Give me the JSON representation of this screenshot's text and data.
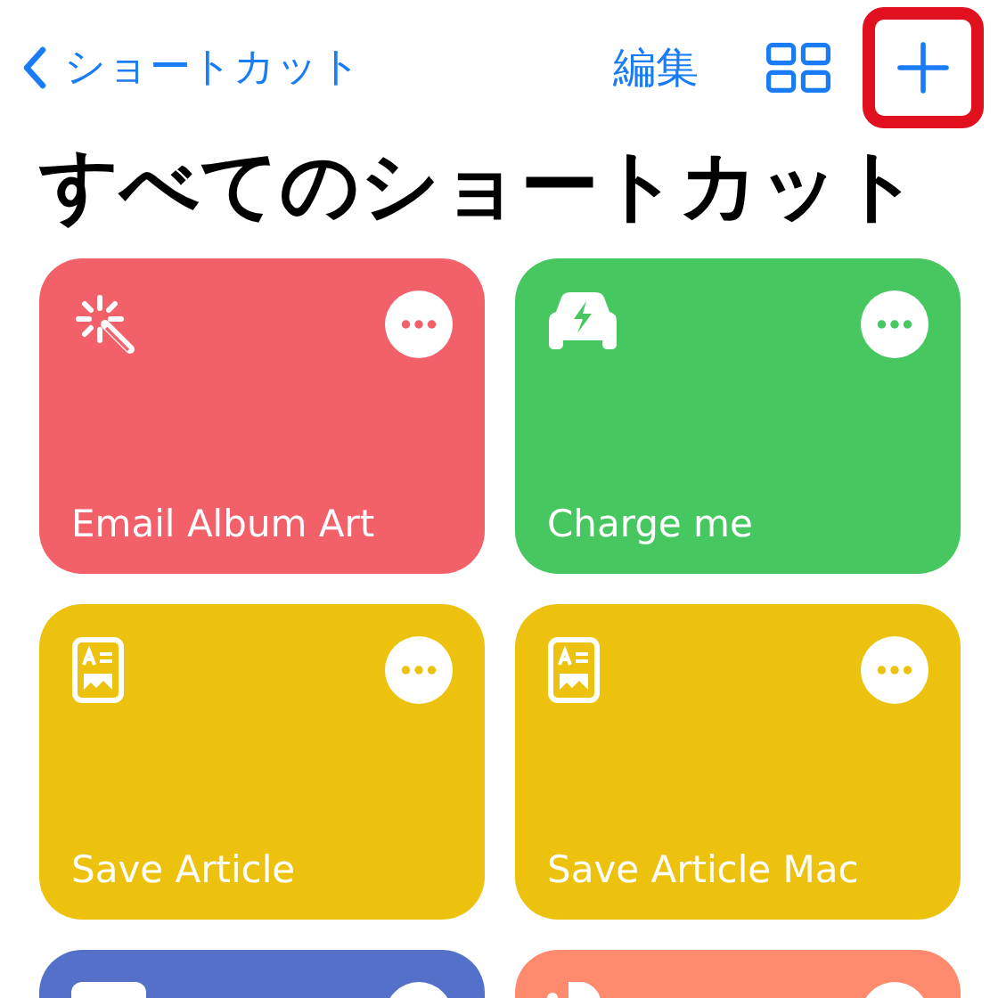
{
  "nav": {
    "back_label": "ショートカット",
    "edit_label": "編集",
    "add_highlighted": true
  },
  "title": "すべてのショートカット",
  "shortcuts": [
    {
      "label": "Email Album Art",
      "color": "#f2606a"
    },
    {
      "label": "Charge me",
      "color": "#46c760"
    },
    {
      "label": "Save Article",
      "color": "#ecc20f"
    },
    {
      "label": "Save Article Mac",
      "color": "#ecc20f"
    },
    {
      "color": "#5470c9"
    },
    {
      "color": "#ff8a6e"
    }
  ]
}
